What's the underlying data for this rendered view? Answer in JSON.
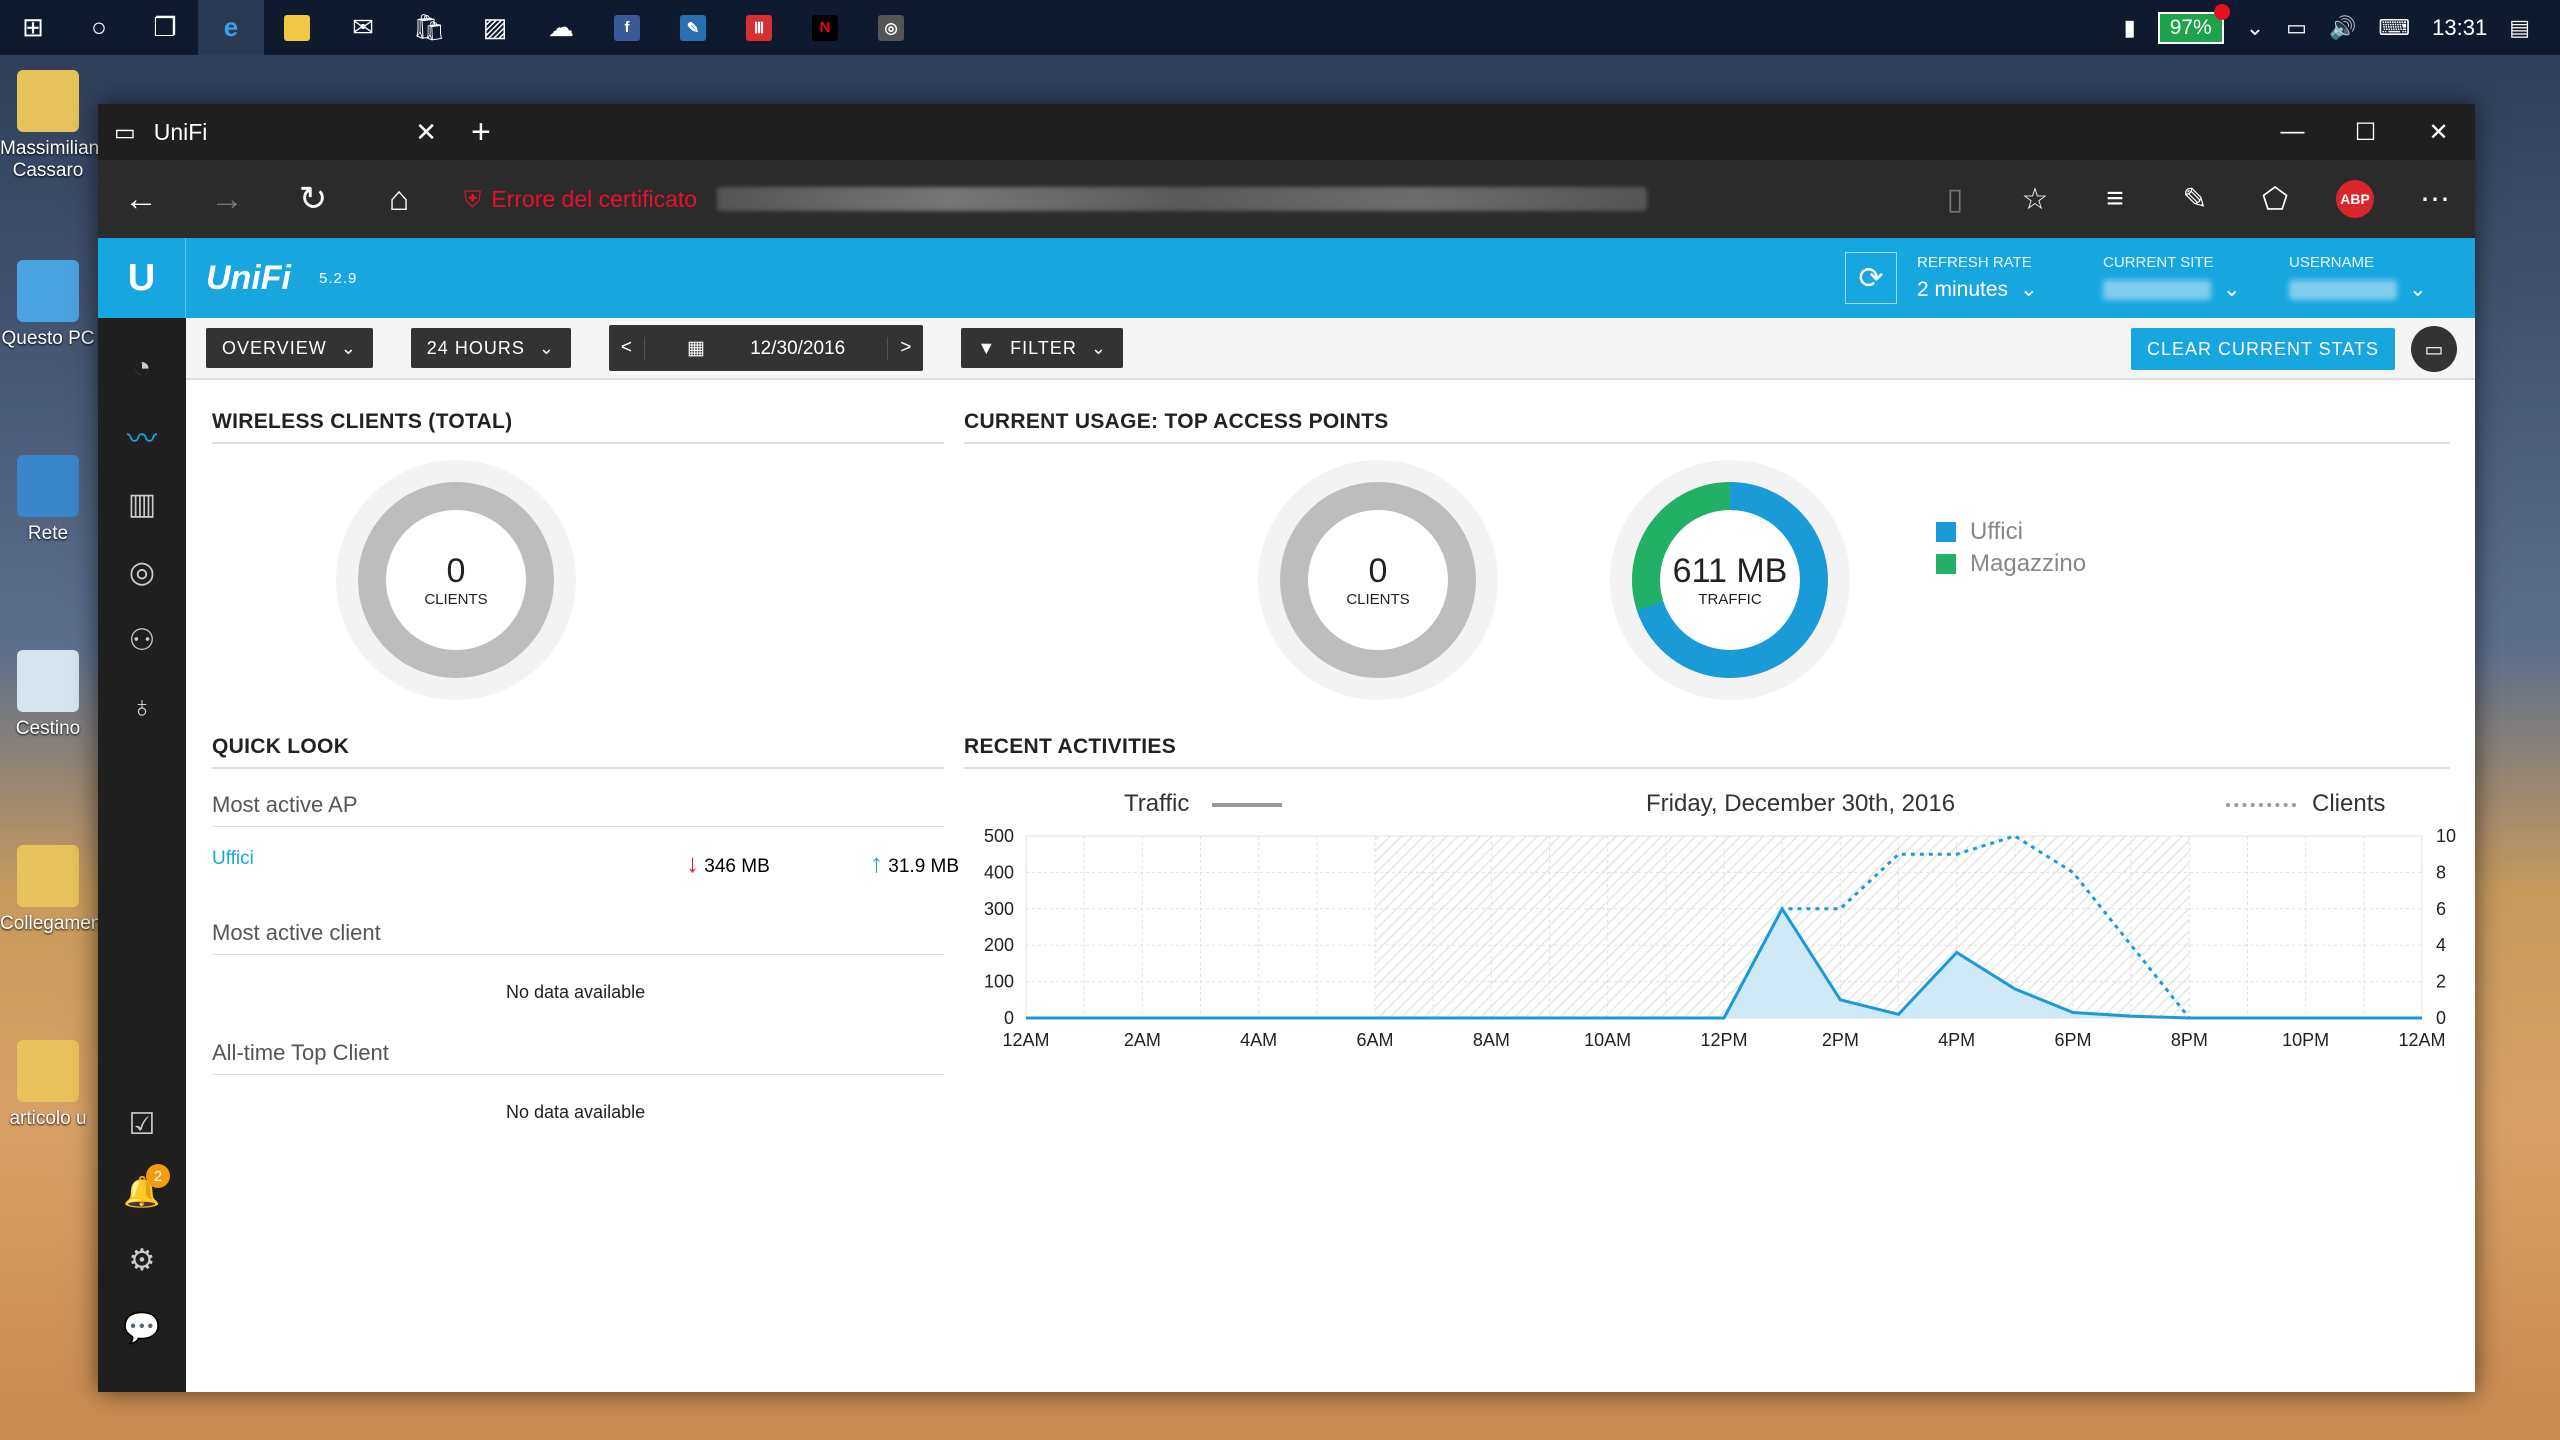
{
  "taskbar": {
    "battery": "97%",
    "clock": "13:31"
  },
  "desktop": {
    "icons": [
      "Massimiliano Cassaro",
      "Questo PC",
      "Rete",
      "Cestino",
      "Collegamento",
      "articolo u"
    ]
  },
  "browser": {
    "tab_title": "UniFi",
    "cert_error": "Errore del certificato",
    "abp_label": "ABP"
  },
  "unifi": {
    "brand": "UniFi",
    "version": "5.2.9",
    "refresh_rate_label": "REFRESH RATE",
    "refresh_rate_value": "2 minutes",
    "current_site_label": "CURRENT SITE",
    "username_label": "USERNAME",
    "notification_count": "2"
  },
  "toolbar": {
    "overview": "OVERVIEW",
    "range": "24 HOURS",
    "date_prev": "<",
    "date": "12/30/2016",
    "date_next": ">",
    "filter": "FILTER",
    "clear_stats": "CLEAR CURRENT STATS"
  },
  "wireless_clients": {
    "title": "WIRELESS CLIENTS (TOTAL)",
    "count": "0",
    "unit": "CLIENTS"
  },
  "top_aps": {
    "title": "CURRENT USAGE: TOP ACCESS POINTS",
    "clients_count": "0",
    "clients_unit": "CLIENTS",
    "traffic_value": "611 MB",
    "traffic_unit": "TRAFFIC",
    "legend": [
      {
        "name": "Uffici",
        "color": "#1a9ad6"
      },
      {
        "name": "Magazzino",
        "color": "#21b066"
      }
    ]
  },
  "quick_look": {
    "title": "QUICK LOOK",
    "most_active_ap_label": "Most active AP",
    "most_active_ap_name": "Uffici",
    "download": "346 MB",
    "upload": "31.9 MB",
    "most_active_client_label": "Most active client",
    "most_active_client_value": "No data available",
    "top_client_label": "All-time Top Client",
    "top_client_value": "No data available"
  },
  "recent": {
    "title": "RECENT ACTIVITIES",
    "traffic_legend": "Traffic",
    "date_heading": "Friday, December 30th, 2016",
    "clients_legend": "Clients"
  },
  "chart_data": {
    "type": "line",
    "x": [
      "12AM",
      "1AM",
      "2AM",
      "3AM",
      "4AM",
      "5AM",
      "6AM",
      "7AM",
      "8AM",
      "9AM",
      "10AM",
      "11AM",
      "12PM",
      "1PM",
      "2PM",
      "3PM",
      "4PM",
      "5PM",
      "6PM",
      "7PM",
      "8PM",
      "9PM",
      "10PM",
      "11PM",
      "12AM"
    ],
    "xticks": [
      "12AM",
      "2AM",
      "4AM",
      "6AM",
      "8AM",
      "10AM",
      "12PM",
      "2PM",
      "4PM",
      "6PM",
      "8PM",
      "10PM",
      "12AM"
    ],
    "series": [
      {
        "name": "Traffic",
        "axis": "left",
        "style": "solid-area",
        "values": [
          0,
          0,
          0,
          0,
          0,
          0,
          0,
          0,
          0,
          0,
          0,
          0,
          0,
          300,
          50,
          10,
          180,
          80,
          15,
          5,
          0,
          0,
          0,
          0,
          0
        ]
      },
      {
        "name": "Clients",
        "axis": "right",
        "style": "dotted",
        "values": [
          0,
          0,
          0,
          0,
          0,
          0,
          0,
          0,
          0,
          0,
          0,
          0,
          0,
          6,
          6,
          9,
          9,
          10,
          8,
          4,
          0,
          0,
          0,
          0,
          0
        ]
      }
    ],
    "ylim_left": [
      0,
      500
    ],
    "yticks_left": [
      "0",
      "100",
      "200",
      "300",
      "400",
      "500"
    ],
    "ylim_right": [
      0,
      10
    ],
    "yticks_right": [
      "0",
      "2",
      "4",
      "6",
      "8",
      "10"
    ],
    "grid": true,
    "legend": "top",
    "colors": {
      "line": "#1a9ad6",
      "area": "#cfe9f7"
    }
  }
}
